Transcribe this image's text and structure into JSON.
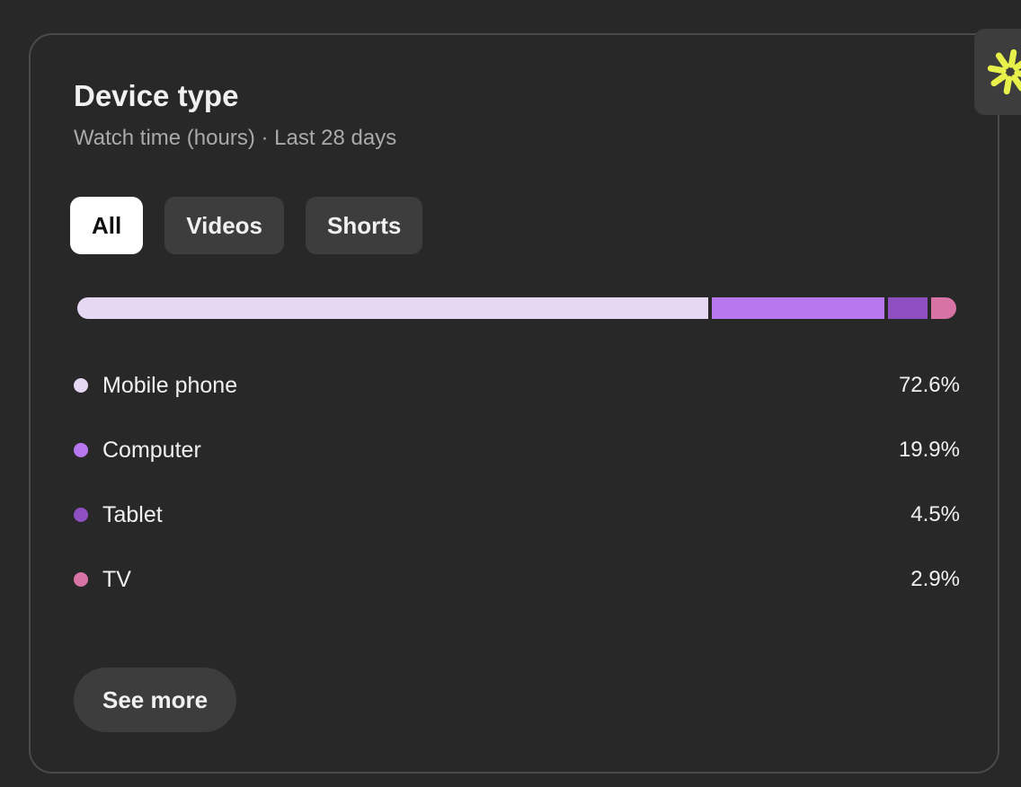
{
  "card": {
    "title": "Device type",
    "subtitle": "Watch time (hours) · Last 28 days"
  },
  "filters": [
    {
      "label": "All",
      "active": true
    },
    {
      "label": "Videos",
      "active": false
    },
    {
      "label": "Shorts",
      "active": false
    }
  ],
  "breakdown": [
    {
      "label": "Mobile phone",
      "value": "72.6%",
      "share": 72.6,
      "color": "#e6d8f3"
    },
    {
      "label": "Computer",
      "value": "19.9%",
      "share": 19.9,
      "color": "#b778ef"
    },
    {
      "label": "Tablet",
      "value": "4.5%",
      "share": 4.5,
      "color": "#8e4fc3"
    },
    {
      "label": "TV",
      "value": "2.9%",
      "share": 2.9,
      "color": "#d873a5"
    }
  ],
  "see_more_label": "See more",
  "side_button": {
    "icon": "sparkle-icon",
    "color": "#e8f04a"
  }
}
